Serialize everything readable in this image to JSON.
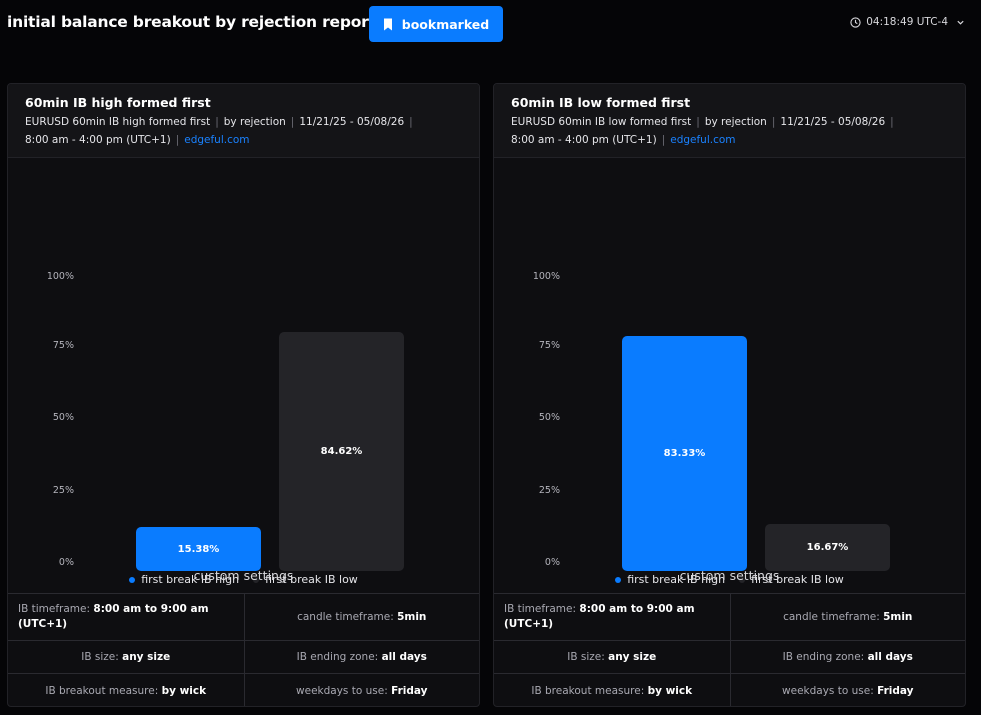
{
  "header": {
    "title": "initial balance breakout by rejection report",
    "bookmark_label": "bookmarked",
    "time": "04:18:49 UTC-4"
  },
  "colors": {
    "accent": "#0a7cff",
    "bar_dark": "#242428",
    "background": "#050507",
    "link": "#1a82ff"
  },
  "cards": [
    {
      "title": "60min IB high formed first",
      "meta_line1": [
        "EURUSD 60min IB high formed first",
        "by rejection",
        "11/21/25 - 05/08/26"
      ],
      "meta_line2": "8:00 am - 4:00 pm (UTC+1)",
      "link": "edgeful.com",
      "chart_data": {
        "type": "bar",
        "categories": [
          "first break IB high",
          "first break IB low"
        ],
        "values": [
          15.38,
          84.62
        ],
        "value_labels": [
          "15.38%",
          "84.62%"
        ],
        "yticks": [
          "100%",
          "75%",
          "50%",
          "25%",
          "0%"
        ],
        "ylim": [
          0,
          100
        ],
        "colors": [
          "#0a7cff",
          "#242428"
        ]
      },
      "custom_settings_title": "custom settings",
      "settings": [
        [
          {
            "k": "IB timeframe:",
            "v": "8:00 am to 9:00 am (UTC+1)"
          },
          {
            "k": "candle timeframe:",
            "v": "5min"
          }
        ],
        [
          {
            "k": "IB size:",
            "v": "any size"
          },
          {
            "k": "IB ending zone:",
            "v": "all days"
          }
        ],
        [
          {
            "k": "IB breakout measure:",
            "v": "by wick"
          },
          {
            "k": "weekdays to use:",
            "v": "Friday"
          }
        ]
      ]
    },
    {
      "title": "60min IB low formed first",
      "meta_line1": [
        "EURUSD 60min IB low formed first",
        "by rejection",
        "11/21/25 - 05/08/26"
      ],
      "meta_line2": "8:00 am - 4:00 pm (UTC+1)",
      "link": "edgeful.com",
      "chart_data": {
        "type": "bar",
        "categories": [
          "first break IB high",
          "first break IB low"
        ],
        "values": [
          83.33,
          16.67
        ],
        "value_labels": [
          "83.33%",
          "16.67%"
        ],
        "yticks": [
          "100%",
          "75%",
          "50%",
          "25%",
          "0%"
        ],
        "ylim": [
          0,
          100
        ],
        "colors": [
          "#0a7cff",
          "#242428"
        ]
      },
      "custom_settings_title": "custom settings",
      "settings": [
        [
          {
            "k": "IB timeframe:",
            "v": "8:00 am to 9:00 am (UTC+1)"
          },
          {
            "k": "candle timeframe:",
            "v": "5min"
          }
        ],
        [
          {
            "k": "IB size:",
            "v": "any size"
          },
          {
            "k": "IB ending zone:",
            "v": "all days"
          }
        ],
        [
          {
            "k": "IB breakout measure:",
            "v": "by wick"
          },
          {
            "k": "weekdays to use:",
            "v": "Friday"
          }
        ]
      ]
    }
  ]
}
